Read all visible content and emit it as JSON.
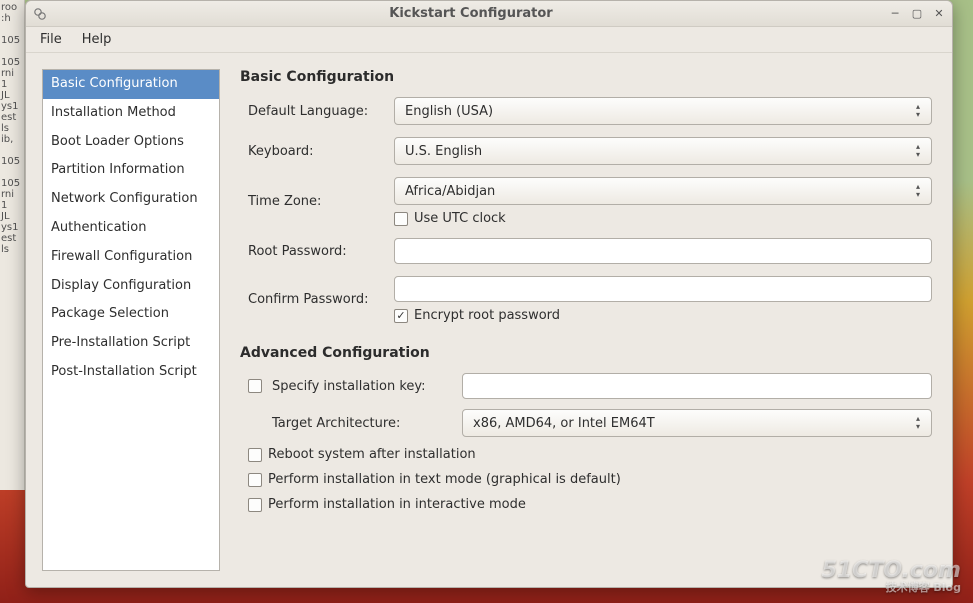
{
  "bg_text": "roo\n:h\n\n105\n\n105\nrni\n1\nJL\nys1\nest\nls\nib,\n\n105\n\n105\nrni\n1\nJL\nys1\nest\nls",
  "window": {
    "title": "Kickstart Configurator"
  },
  "menubar": {
    "file": "File",
    "help": "Help"
  },
  "sidebar": {
    "items": [
      "Basic Configuration",
      "Installation Method",
      "Boot Loader Options",
      "Partition Information",
      "Network Configuration",
      "Authentication",
      "Firewall Configuration",
      "Display Configuration",
      "Package Selection",
      "Pre-Installation Script",
      "Post-Installation Script"
    ],
    "selected_index": 0
  },
  "basic": {
    "heading": "Basic Configuration",
    "default_language_label": "Default Language:",
    "default_language_value": "English (USA)",
    "keyboard_label": "Keyboard:",
    "keyboard_value": "U.S. English",
    "timezone_label": "Time Zone:",
    "timezone_value": "Africa/Abidjan",
    "utc_label": "Use UTC clock",
    "utc_checked": false,
    "root_pw_label": "Root Password:",
    "root_pw_value": "",
    "confirm_pw_label": "Confirm Password:",
    "confirm_pw_value": "",
    "encrypt_label": "Encrypt root password",
    "encrypt_checked": true
  },
  "advanced": {
    "heading": "Advanced Configuration",
    "specify_key_label": "Specify installation key:",
    "specify_key_checked": false,
    "specify_key_value": "",
    "target_arch_label": "Target Architecture:",
    "target_arch_value": "x86, AMD64, or Intel EM64T",
    "reboot_label": "Reboot system after installation",
    "reboot_checked": false,
    "textmode_label": "Perform installation in text mode (graphical is default)",
    "textmode_checked": false,
    "interactive_label": "Perform installation in interactive mode",
    "interactive_checked": false
  },
  "watermark": {
    "main": "51CTO.com",
    "sub": "技术博客        Blog"
  }
}
